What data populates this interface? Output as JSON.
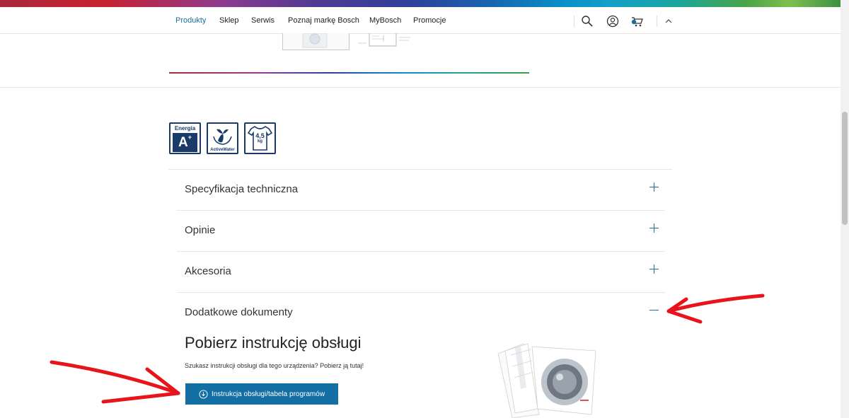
{
  "nav": {
    "items": [
      "Produkty",
      "Sklep",
      "Serwis",
      "Poznaj markę Bosch",
      "MyBosch",
      "Promocje"
    ],
    "active_index": 0,
    "icons": [
      "search-icon",
      "user-icon",
      "cart-icon",
      "chevron-up-icon"
    ]
  },
  "badges": {
    "energy": {
      "label": "Energia",
      "class": "A",
      "plus": "+"
    },
    "water": {
      "label": "ActiveWater"
    },
    "load": {
      "value": "4,5",
      "unit": "kg"
    }
  },
  "accordion": {
    "items": [
      {
        "title": "Specyfikacja techniczna",
        "state": "collapsed"
      },
      {
        "title": "Opinie",
        "state": "collapsed"
      },
      {
        "title": "Akcesoria",
        "state": "collapsed"
      },
      {
        "title": "Dodatkowe dokumenty",
        "state": "expanded"
      }
    ]
  },
  "documents": {
    "heading": "Pobierz instrukcję obsługi",
    "text": "Szukasz instrukcji obsługi dla tego urządzenia? Pobierz ją tutaj!",
    "button_label": "Instrukcja obsługi/tabela programów"
  },
  "colors": {
    "accent": "#126ea3",
    "link_active": "#1a6fa0",
    "badge_navy": "#1a3a6a",
    "annotation_red": "#e8141b"
  }
}
